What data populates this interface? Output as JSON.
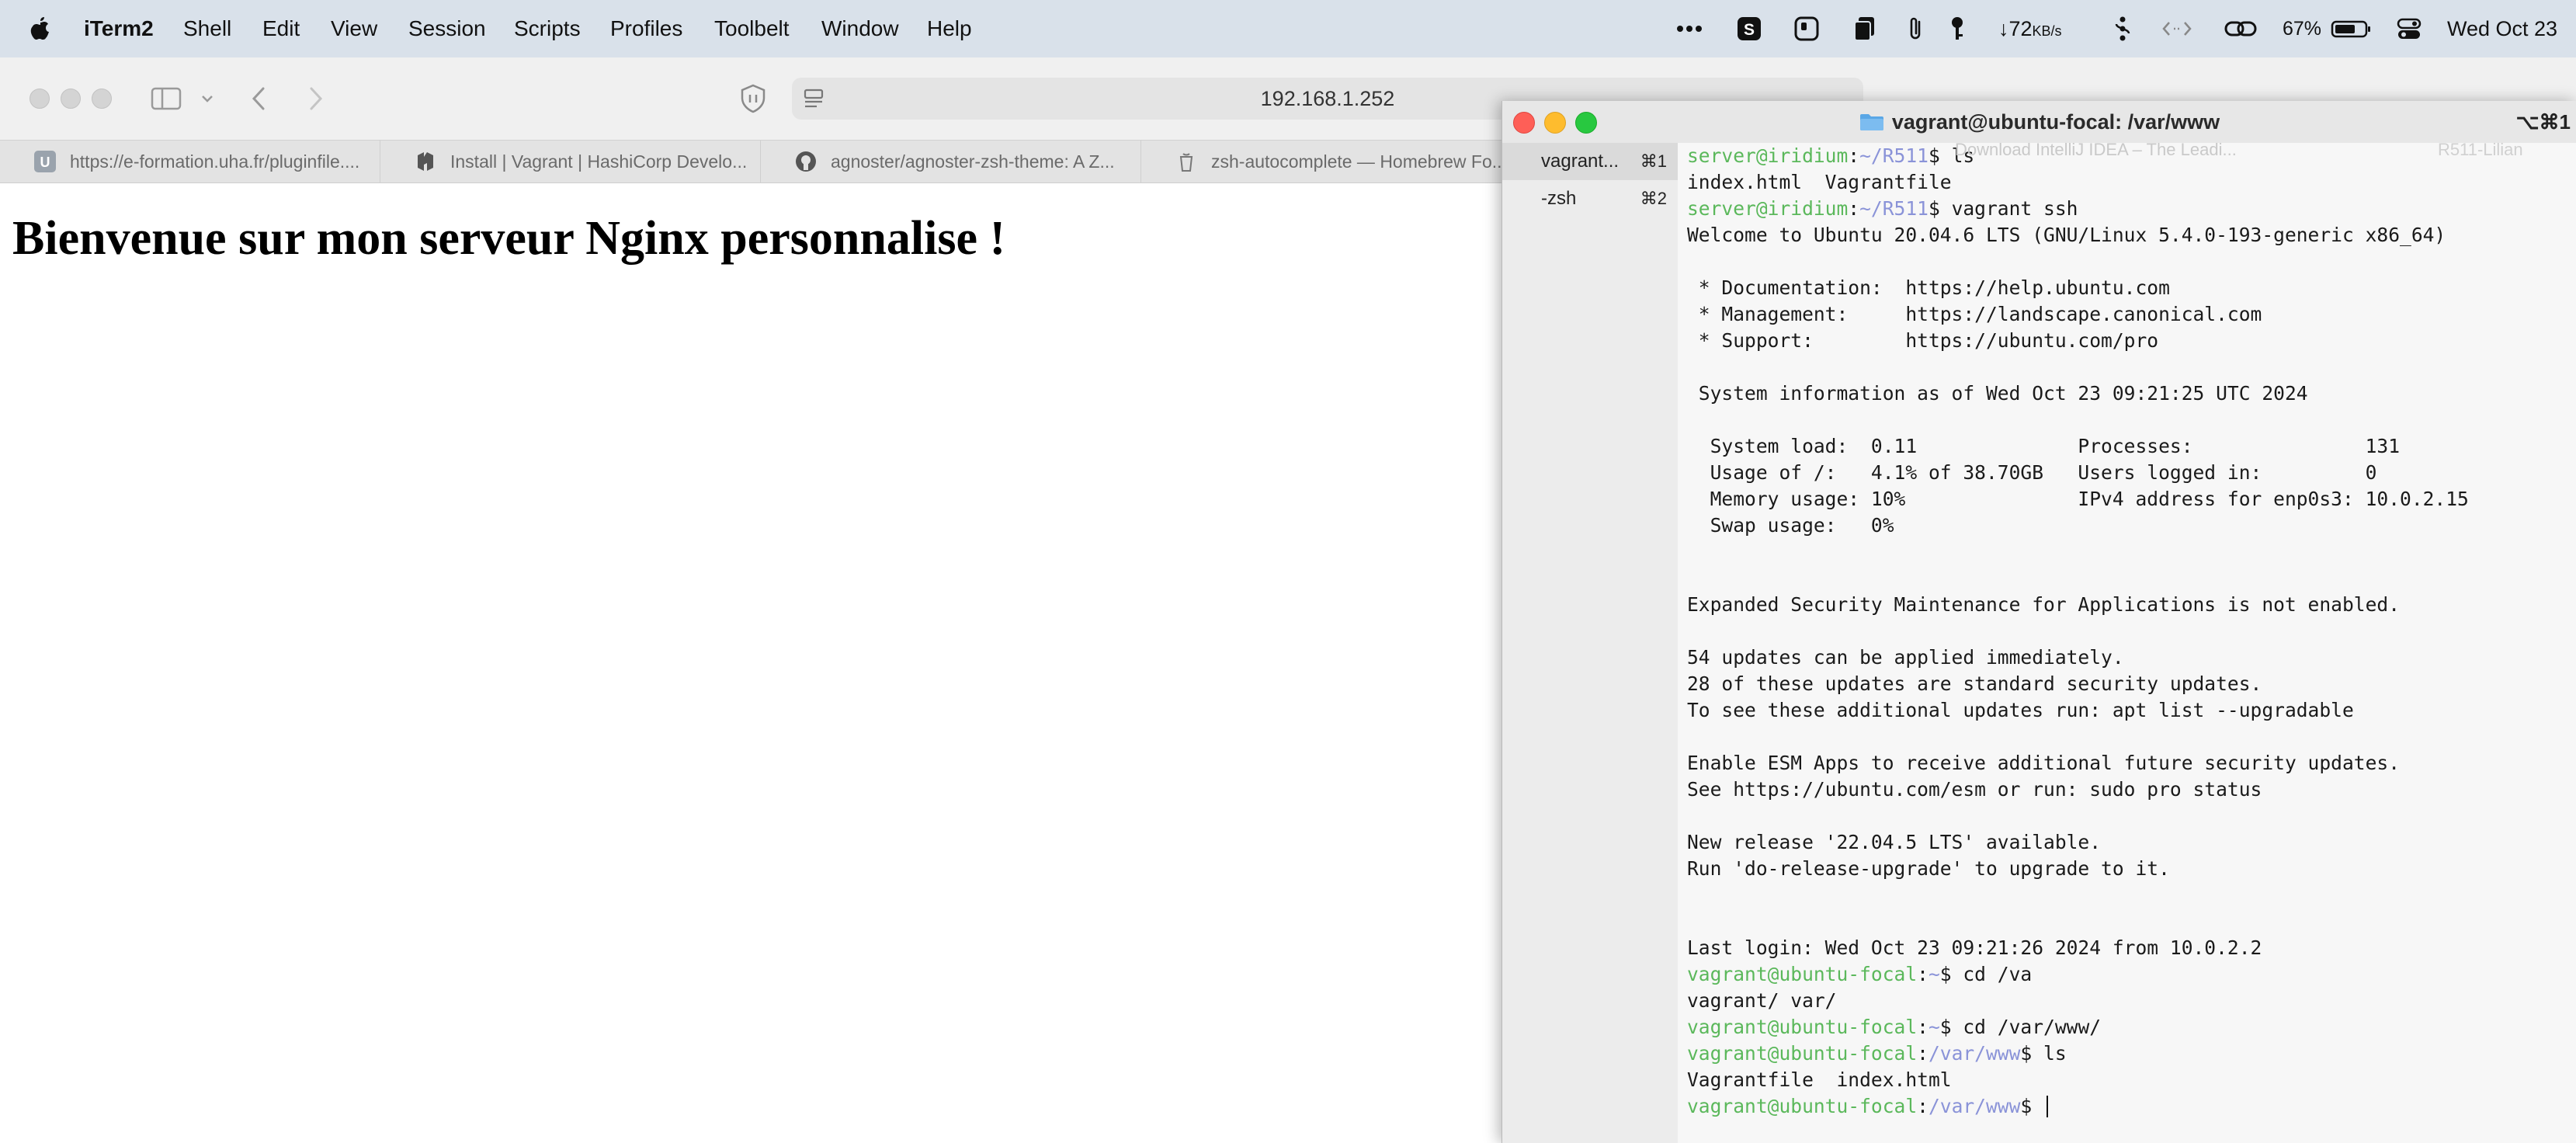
{
  "menubar": {
    "app_name": "iTerm2",
    "menus": [
      "Shell",
      "Edit",
      "View",
      "Session",
      "Scripts",
      "Profiles",
      "Toolbelt",
      "Window",
      "Help"
    ],
    "status": {
      "network_speed": "↓72",
      "network_unit": "KB/s",
      "battery_percent": "67%",
      "datetime": "Wed Oct 23"
    },
    "icons": [
      "apple-logo-icon",
      "more-icon",
      "skype-icon",
      "app-icon",
      "clipboard-icon",
      "paperclip-icon",
      "key-icon",
      "network-speed-icon",
      "tailscale-icon",
      "code-icon",
      "link-icon",
      "battery-icon",
      "control-center-icon"
    ]
  },
  "safari": {
    "url": "192.168.1.252",
    "tabs": [
      {
        "label": "https://e-formation.uha.fr/pluginfile....",
        "icon": "uha-favicon"
      },
      {
        "label": "Install | Vagrant | HashiCorp Develo...",
        "icon": "hashicorp-favicon"
      },
      {
        "label": "agnoster/agnoster-zsh-theme: A Z...",
        "icon": "github-favicon"
      },
      {
        "label": "zsh-autocomplete — Homebrew Fo...",
        "icon": "homebrew-favicon"
      }
    ],
    "behind_tabs": [
      "Download IntelliJ IDEA – The Leadi...",
      "R511-Lilian"
    ],
    "page_heading": "Bienvenue sur mon serveur Nginx personnalise !"
  },
  "iterm": {
    "title": "vagrant@ubuntu-focal: /var/www",
    "title_shortcut": "⌥⌘1",
    "tabs": [
      {
        "label": "vagrant...",
        "shortcut": "⌘1",
        "selected": true
      },
      {
        "label": "-zsh",
        "shortcut": "⌘2",
        "selected": false
      }
    ],
    "terminal": {
      "l0": {
        "user": "server@iridium",
        "sep": ":",
        "path": "~/R511",
        "cmd": "$ ls"
      },
      "l1": "index.html  Vagrantfile",
      "l2": {
        "user": "server@iridium",
        "sep": ":",
        "path": "~/R511",
        "cmd": "$ vagrant ssh"
      },
      "l3": "Welcome to Ubuntu 20.04.6 LTS (GNU/Linux 5.4.0-193-generic x86_64)",
      "l5": " * Documentation:  https://help.ubuntu.com",
      "l6": " * Management:     https://landscape.canonical.com",
      "l7": " * Support:        https://ubuntu.com/pro",
      "l9": " System information as of Wed Oct 23 09:21:25 UTC 2024",
      "l11": "  System load:  0.11              Processes:               131",
      "l12": "  Usage of /:   4.1% of 38.70GB   Users logged in:         0",
      "l13": "  Memory usage: 10%               IPv4 address for enp0s3: 10.0.2.15",
      "l14": "  Swap usage:   0%",
      "l17": "Expanded Security Maintenance for Applications is not enabled.",
      "l19": "54 updates can be applied immediately.",
      "l20": "28 of these updates are standard security updates.",
      "l21": "To see these additional updates run: apt list --upgradable",
      "l23": "Enable ESM Apps to receive additional future security updates.",
      "l24": "See https://ubuntu.com/esm or run: sudo pro status",
      "l26": "New release '22.04.5 LTS' available.",
      "l27": "Run 'do-release-upgrade' to upgrade to it.",
      "l30": "Last login: Wed Oct 23 09:21:26 2024 from 10.0.2.2",
      "l31": {
        "user": "vagrant@ubuntu-focal",
        "sep": ":",
        "path": "~",
        "cmd": "$ cd /va"
      },
      "l32": "vagrant/ var/",
      "l33": {
        "user": "vagrant@ubuntu-focal",
        "sep": ":",
        "path": "~",
        "cmd": "$ cd /var/www/"
      },
      "l34": {
        "user": "vagrant@ubuntu-focal",
        "sep": ":",
        "path": "/var/www",
        "cmd": "$ ls"
      },
      "l35": "Vagrantfile  index.html",
      "l36": {
        "user": "vagrant@ubuntu-focal",
        "sep": ":",
        "path": "/var/www",
        "cmd": "$ "
      }
    }
  },
  "colors": {
    "prompt_green": "#5bb85b",
    "path_blue": "#8a93d8",
    "menubar_bg": "#d9e1ea",
    "close_red": "#fe5f57",
    "minimize_yellow": "#febc2e",
    "zoom_green": "#28c840"
  }
}
